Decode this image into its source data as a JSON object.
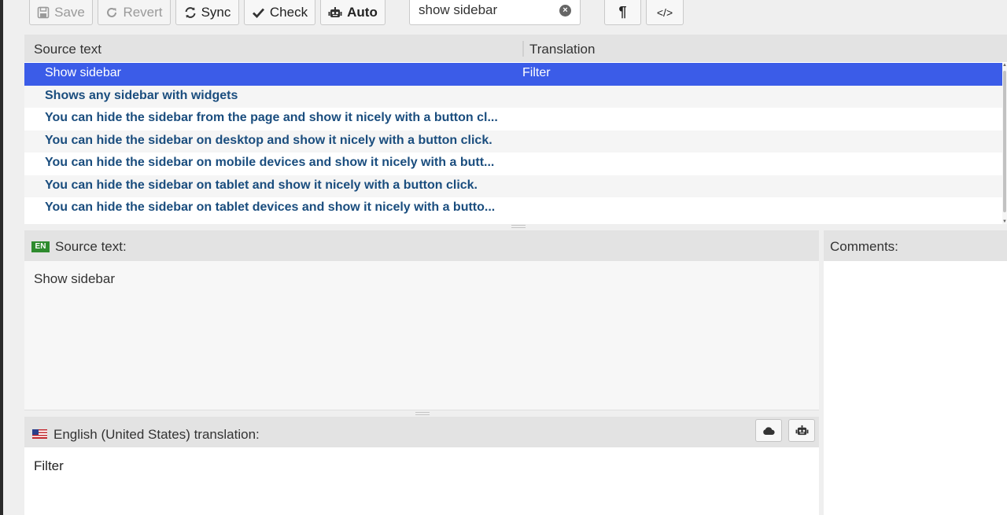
{
  "toolbar": {
    "save_label": "Save",
    "revert_label": "Revert",
    "sync_label": "Sync",
    "check_label": "Check",
    "auto_label": "Auto",
    "search_value": "show sidebar",
    "pilcrow_icon": "¶",
    "code_icon": "</>"
  },
  "list": {
    "header_source": "Source text",
    "header_translation": "Translation",
    "rows": [
      {
        "source": "Show sidebar",
        "translation": "Filter"
      },
      {
        "source": "Shows any sidebar with widgets",
        "translation": ""
      },
      {
        "source": "You can hide the sidebar from the page and show it nicely with a button cl...",
        "translation": ""
      },
      {
        "source": "You can hide the sidebar on desktop and show it nicely with a button click.",
        "translation": ""
      },
      {
        "source": "You can hide the sidebar on mobile devices and show it nicely with a butt...",
        "translation": ""
      },
      {
        "source": "You can hide the sidebar on tablet and show it nicely with a button click.",
        "translation": ""
      },
      {
        "source": "You can hide the sidebar on tablet devices and show it nicely with a butto...",
        "translation": ""
      }
    ]
  },
  "source_pane": {
    "lang_badge": "EN",
    "title": "Source text:",
    "text": "Show sidebar"
  },
  "translation_pane": {
    "title": "English (United States) translation:",
    "text": "Filter"
  },
  "comments_pane": {
    "title": "Comments:"
  },
  "colors": {
    "selection": "#3b5ce8",
    "source_link_text": "#1a4d7e",
    "lang_badge": "#2e8b2e"
  }
}
